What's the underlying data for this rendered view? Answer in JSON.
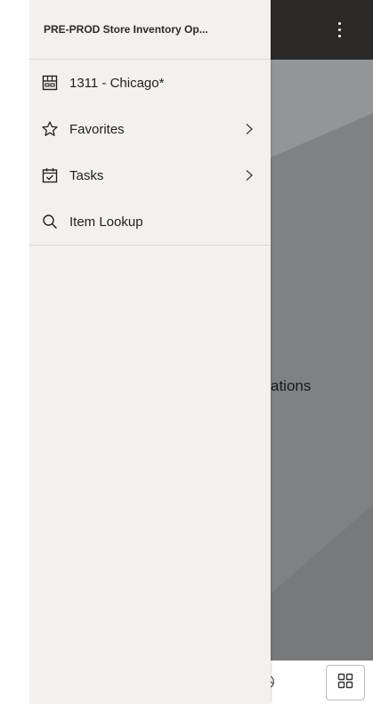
{
  "drawer": {
    "title": "PRE-PROD Store Inventory Op...",
    "items": [
      {
        "label": "1311 - Chicago*",
        "icon": "store-icon",
        "has_submenu": false
      },
      {
        "label": "Favorites",
        "icon": "star-icon",
        "has_submenu": true
      },
      {
        "label": "Tasks",
        "icon": "calendar-check-icon",
        "has_submenu": true
      },
      {
        "label": "Item Lookup",
        "icon": "search-icon",
        "has_submenu": false
      }
    ]
  },
  "background": {
    "partial_text": "ations"
  },
  "colors": {
    "header_bg": "#2c2a29",
    "drawer_bg": "#f2f1ef",
    "content_bg": "#8a8d90"
  }
}
